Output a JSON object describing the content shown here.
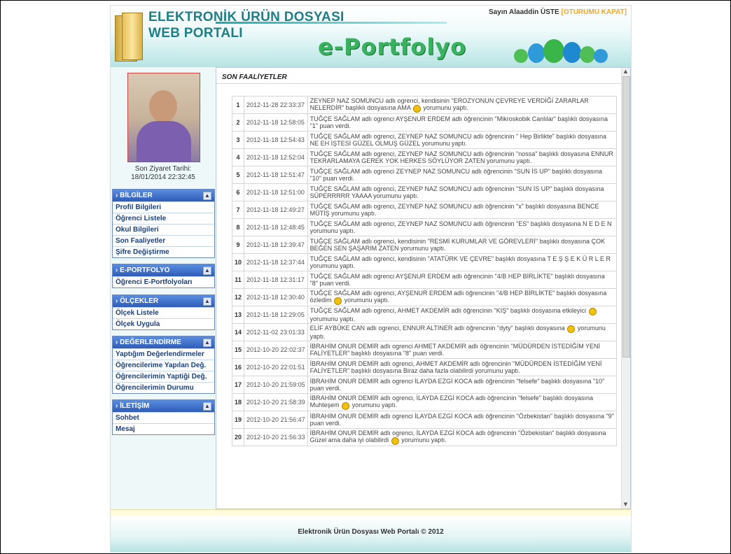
{
  "header": {
    "title_line1": "ELEKTRONİK ÜRÜN DOSYASI",
    "title_line2": "WEB PORTALI",
    "logo_text": "e-Portfolyo",
    "user_greeting": "Sayın Alaaddin ÜSTE",
    "logout_label": "[OTURUMU KAPAT]"
  },
  "sidebar": {
    "visit_label": "Son Ziyaret Tarihi:",
    "visit_value": "18/01/2014 22:32:45",
    "groups": [
      {
        "title": "› BİLGİLER",
        "toggle": "▲",
        "items": [
          "Profil Bilgileri",
          "Öğrenci Listele",
          "Okul Bilgileri",
          "Son Faaliyetler",
          "Şifre Değiştirme"
        ]
      },
      {
        "title": "› E-PORTFOLYO",
        "toggle": "▲",
        "items": [
          "Öğrenci E-Portfolyoları"
        ]
      },
      {
        "title": "› ÖLÇEKLER",
        "toggle": "▲",
        "items": [
          "Ölçek Listele",
          "Ölçek Uygula"
        ]
      },
      {
        "title": "› DEĞERLENDİRME",
        "toggle": "▲",
        "items": [
          "Yaptığım Değerlendirmeler",
          "Öğrencilerime Yapılan Değ.",
          "Öğrencilerimin Yaptiği Değ.",
          "Öğrencilerimin Durumu"
        ]
      },
      {
        "title": "› İLETİŞİM",
        "toggle": "▲",
        "items": [
          "Sohbet",
          "Mesaj"
        ]
      }
    ]
  },
  "main": {
    "section_title": "SON FAALİYETLER",
    "activities": [
      {
        "num": "1",
        "date": "2012-11-28 22:33:37",
        "text_a": "ZEYNEP NAZ SOMUNCU adlı ogrenci, kendisinin \"EROZYONUN ÇEVREYE VERDİĞİ ZARARLAR NELERDİR\" başlıklı dosyasına AMA",
        "text_b": "yorumunu yaptı.",
        "smile": true
      },
      {
        "num": "2",
        "date": "2012-11-18 12:58:05",
        "text_a": "TUĞÇE SAĞLAM adlı ogrenci AYŞENUR ERDEM adlı öğrencinin \"Mikroskobik Canlılar\" başlıklı dosyasına \"1\" puan verdi.",
        "text_b": "",
        "smile": false
      },
      {
        "num": "3",
        "date": "2012-11-18 12:54:43",
        "text_a": "TUĞÇE SAĞLAM adlı ogrenci, ZEYNEP NAZ SOMUNCU adlı öğrencinin \" Hep Birlikte\" başlıklı dosyasına NE EH İŞTESİ GÜZEL OLMUŞ GÜZEL yorumunu yaptı.",
        "text_b": "",
        "smile": false
      },
      {
        "num": "4",
        "date": "2012-11-18 12:52:04",
        "text_a": "TUĞÇE SAĞLAM adlı ogrenci, ZEYNEP NAZ SOMUNCU adlı öğrencinin \"nossa\" başlıklı dosyasına ENNUR TEKRARLAMAYA GEREK YOK HERKES SÖYLÜYOR ZATEN yorumunu yaptı.",
        "text_b": "",
        "smile": false
      },
      {
        "num": "5",
        "date": "2012-11-18 12:51:47",
        "text_a": "TUĞÇE SAĞLAM adlı ogrenci ZEYNEP NAZ SOMUNCU adlı öğrencinin \"SUN İS UP\" başlıklı dosyasına \"10\" puan verdi.",
        "text_b": "",
        "smile": false
      },
      {
        "num": "6",
        "date": "2012-11-18 12:51:00",
        "text_a": "TUĞÇE SAĞLAM adlı ogrenci, ZEYNEP NAZ SOMUNCU adlı öğrencinin \"SUN İS UP\" başlıklı dosyasına SÜPERRRRR YAAAA yorumunu yaptı.",
        "text_b": "",
        "smile": false
      },
      {
        "num": "7",
        "date": "2012-11-18 12:49:27",
        "text_a": "TUĞÇE SAĞLAM adlı ogrenci, ZEYNEP NAZ SOMUNCU adlı öğrencinin \"x\" başlıklı dosyasına BENCE MÜTİŞ yorumunu yaptı.",
        "text_b": "",
        "smile": false
      },
      {
        "num": "8",
        "date": "2012-11-18 12:48:45",
        "text_a": "TUĞÇE SAĞLAM adlı ogrenci, ZEYNEP NAZ SOMUNCU adlı öğrencinin \"ES\" başlıklı dosyasına N E D E N yorumunu yaptı.",
        "text_b": "",
        "smile": false
      },
      {
        "num": "9",
        "date": "2012-11-18 12:39:47",
        "text_a": "TUĞÇE SAĞLAM adlı ogrenci, kendisinin \"RESMİ KURUMLAR VE GÖREVLERİ\" başlıklı dosyasına ÇOK BEĞEN SEN ŞAŞARIM ZATEN yorumunu yaptı.",
        "text_b": "",
        "smile": false
      },
      {
        "num": "10",
        "date": "2012-11-18 12:37:44",
        "text_a": "TUĞÇE SAĞLAM adlı ogrenci, kendisinin \"ATATÜRK VE ÇEVRE\" başlıklı dosyasına T E Ş Ş E K Ü R L E R yorumunu yaptı.",
        "text_b": "",
        "smile": false
      },
      {
        "num": "11",
        "date": "2012-11-18 12:31:17",
        "text_a": "TUĞÇE SAĞLAM adlı ogrenci AYŞENUR ERDEM adlı öğrencinin \"4/B HEP BİRLİKTE\" başlıklı dosyasına \"8\" puan verdi.",
        "text_b": "",
        "smile": false
      },
      {
        "num": "12",
        "date": "2012-11-18 12:30:40",
        "text_a": "TUĞÇE SAĞLAM adlı ogrenci, AYŞENUR ERDEM adlı öğrencinin \"4/B HEP BİRLİKTE\" başlıklı dosyasına özledim",
        "text_b": "yorumunu yaptı.",
        "smile": true
      },
      {
        "num": "13",
        "date": "2012-11-18 12:29:05",
        "text_a": "TUĞÇE SAĞLAM adlı ogrenci, AHMET AKDEMİR adlı öğrencinin \"KIŞ\" başlıklı dosyasına etkileyici",
        "text_b": "yorumunu yaptı.",
        "smile": true
      },
      {
        "num": "14",
        "date": "2012-11-02 23:01:33",
        "text_a": "ELİF AYBÜKE CAN adlı ogrenci, ENNUR ALTINER adlı öğrencinin \"dyty\" başlıklı dosyasına",
        "text_b": "yorumunu yaptı.",
        "smile": true
      },
      {
        "num": "15",
        "date": "2012-10-20 22:02:37",
        "text_a": "İBRAHİM ONUR DEMİR adlı ogrenci AHMET AKDEMİR adlı öğrencinin \"MÜDÜRDEN İSTEDİĞİM YENİ FALİYETLER\" başlıklı dosyasına \"8\" puan verdi.",
        "text_b": "",
        "smile": false
      },
      {
        "num": "16",
        "date": "2012-10-20 22:01:51",
        "text_a": "İBRAHİM ONUR DEMİR adlı ogrenci, AHMET AKDEMİR adlı öğrencinin \"MÜDÜRDEN İSTEDİĞİM YENİ FALİYETLER\" başlıklı dosyasına Biraz daha fazla olabilirdi yorumunu yaptı.",
        "text_b": "",
        "smile": false
      },
      {
        "num": "17",
        "date": "2012-10-20 21:59:05",
        "text_a": "İBRAHİM ONUR DEMİR adlı ogrenci İLAYDA EZGİ KOCA adlı öğrencinin \"felsefe\" başlıklı dosyasına \"10\" puan verdi.",
        "text_b": "",
        "smile": false
      },
      {
        "num": "18",
        "date": "2012-10-20 21:58:39",
        "text_a": "İBRAHİM ONUR DEMİR adlı ogrenci, İLAYDA EZGİ KOCA adlı öğrencinin \"felsefe\" başlıklı dosyasına Muhteşem",
        "text_b": "yorumunu yaptı.",
        "smile": true
      },
      {
        "num": "19",
        "date": "2012-10-20 21:56:47",
        "text_a": "İBRAHİM ONUR DEMİR adlı ogrenci İLAYDA EZGİ KOCA adlı öğrencinin \"Özbekistan\" başlıklı dosyasına \"9\" puan verdi.",
        "text_b": "",
        "smile": false
      },
      {
        "num": "20",
        "date": "2012-10-20 21:56:33",
        "text_a": "İBRAHİM ONUR DEMİR adlı ogrenci, İLAYDA EZGİ KOCA adlı öğrencinin \"Özbekistan\" başlıklı dosyasına Güzel ama daha iyi olabilirdi",
        "text_b": "yorumunu yaptı.",
        "smile": true
      }
    ]
  },
  "footer": {
    "text": "Elektronik Ürün Dosyası Web Portalı © 2012"
  }
}
